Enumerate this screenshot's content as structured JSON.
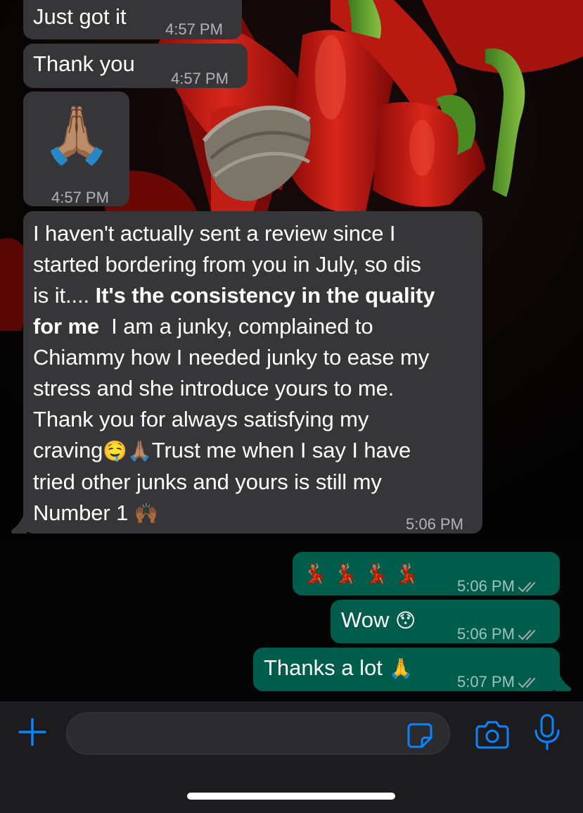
{
  "messages_in": [
    {
      "text": "Just got it",
      "time": "4:57 PM"
    },
    {
      "text": "Thank you",
      "time": "4:57 PM"
    },
    {
      "emoji": "🙏🏽",
      "time": "4:57 PM"
    }
  ],
  "review": {
    "line1": "I haven't actually sent a review since I",
    "line2": "started bordering from you in July, so dis",
    "line3_a": "is it.... ",
    "line3_b": "It's the consistency in the quality",
    "line4_a": "for me",
    "line4_b": "  I am a junky, complained to",
    "line5": "Chiammy how I needed junky to ease my",
    "line6": "stress and she introduce yours to me.",
    "line7": "Thank you for always satisfying my",
    "line8_a": "craving",
    "line8_emoji1": "🤤",
    "line8_emoji2": "🙏🏽",
    "line8_b": "Trust me when I say I have",
    "line9": "tried other junks and yours is still my",
    "line10_a": "Number 1 ",
    "line10_emoji": "🙌🏾",
    "time": "5:06 PM"
  },
  "messages_out": [
    {
      "text": "💃🏽 💃🏽 💃🏽 💃🏽",
      "time": "5:06 PM"
    },
    {
      "text": "Wow ",
      "emoji": "😯",
      "time": "5:06 PM"
    },
    {
      "text": "Thanks a lot ",
      "emoji": "🙏",
      "time": "5:07 PM"
    }
  ],
  "input": {
    "placeholder": ""
  },
  "icons": {
    "plus": "plus-icon",
    "sticker": "sticker-icon",
    "camera": "camera-icon",
    "mic": "microphone-icon",
    "read_receipt": "double-check-icon"
  },
  "colors": {
    "incoming_bubble": "#363638",
    "outgoing_bubble": "#005c4b",
    "accent": "#0a84ff",
    "read_tick": "#8e8e93"
  }
}
